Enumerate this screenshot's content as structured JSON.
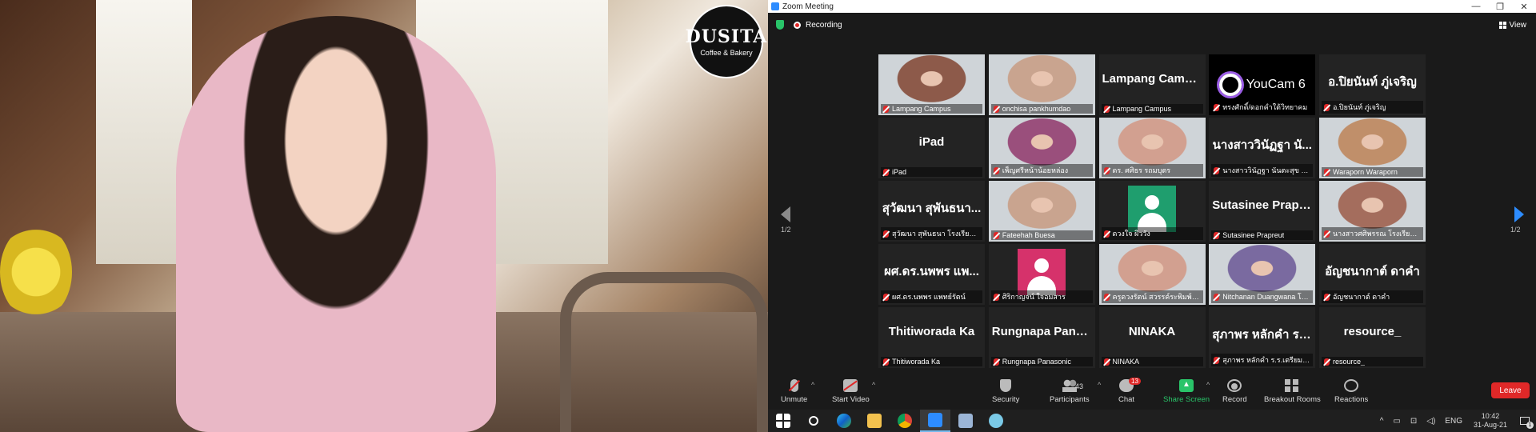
{
  "shared_video": {
    "logo_line1": "DUSITA",
    "logo_line2": "Coffee & Bakery"
  },
  "window": {
    "title": "Zoom Meeting"
  },
  "topbar": {
    "recording_label": "Recording",
    "view_label": "View"
  },
  "gallery": {
    "page_indicator_left": "1/2",
    "page_indicator_right": "1/2",
    "tiles": [
      {
        "display": "",
        "name": "Lampang Campus",
        "kind": "video",
        "active": true
      },
      {
        "display": "",
        "name": "onchisa pankhumdao",
        "kind": "video"
      },
      {
        "display": "Lampang Campus",
        "name": "Lampang Campus",
        "kind": "text"
      },
      {
        "display": "YouCam 6",
        "name": "ทรงศักดิ์/ดอกคำใต้วิทยาคม",
        "kind": "youcam"
      },
      {
        "display": "อ.ปิยนันท์ ภู่เจริญ",
        "name": "อ.ปิยนันท์ ภู่เจริญ",
        "kind": "text"
      },
      {
        "display": "iPad",
        "name": "iPad",
        "kind": "text"
      },
      {
        "display": "",
        "name": "เพ็ญศรีหน้าน้อยหล่อง",
        "kind": "video"
      },
      {
        "display": "",
        "name": "ดร. ศศิธร รถมบุตร",
        "kind": "video"
      },
      {
        "display": "นางสาววินัฏฐา นั...",
        "name": "นางสาววินัฏฐา นันตะสุข โรงรี...",
        "kind": "text"
      },
      {
        "display": "",
        "name": "Waraporn Waraporn",
        "kind": "video"
      },
      {
        "display": "สุวัฒนา สุพันธนา...",
        "name": "สุวัฒนา สุพันธนา โรงเรียนพิบู...",
        "kind": "text"
      },
      {
        "display": "",
        "name": "Fateehah Buesa",
        "kind": "video"
      },
      {
        "display": "",
        "name": "ดวงใจ ผิววัง",
        "kind": "avatar",
        "avatar_color": "#1f9e6e"
      },
      {
        "display": "Sutasinee Prapr...",
        "name": "Sutasinee Prapreut",
        "kind": "text"
      },
      {
        "display": "",
        "name": "นางสาวศศิพรรณ โรงเรียนดาร...",
        "kind": "video"
      },
      {
        "display": "ผศ.ดร.นพพร แพ...",
        "name": "ผศ.ดร.นพพร แพทย์รัตน์",
        "kind": "text"
      },
      {
        "display": "",
        "name": "ศิริกาญจน์ ใจอมสาร",
        "kind": "avatar",
        "avatar_color": "#d6326b"
      },
      {
        "display": "",
        "name": "ครูดวงรัตน์ สวรรค์ระพิมพ์วิทยา",
        "kind": "video"
      },
      {
        "display": "",
        "name": "Nitchanan Duangwana โร...",
        "kind": "video"
      },
      {
        "display": "อัญชนากาต์ ดาคำ",
        "name": "อัญชนากาต์ ดาคำ",
        "kind": "text"
      },
      {
        "display": "Thitiworada Ka",
        "name": "Thitiworada Ka",
        "kind": "text"
      },
      {
        "display": "Rungnapa Pana...",
        "name": "Rungnapa Panasonic",
        "kind": "text"
      },
      {
        "display": "NINAKA",
        "name": "NINAKA",
        "kind": "text"
      },
      {
        "display": "สุภาพร หลักคำ ร....",
        "name": "สุภาพร หลักคำ ร.ร.เตรียมอุดม...",
        "kind": "text"
      },
      {
        "display": "resource_",
        "name": "resource_",
        "kind": "text"
      }
    ]
  },
  "toolbar": {
    "unmute": "Unmute",
    "start_video": "Start Video",
    "security": "Security",
    "participants": "Participants",
    "participants_count": "43",
    "chat": "Chat",
    "chat_badge": "13",
    "share_screen": "Share Screen",
    "record": "Record",
    "breakout_rooms": "Breakout Rooms",
    "reactions": "Reactions",
    "leave": "Leave"
  },
  "taskbar": {
    "language": "ENG",
    "time": "10:42",
    "date": "31-Aug-21",
    "notification_count": "1"
  }
}
